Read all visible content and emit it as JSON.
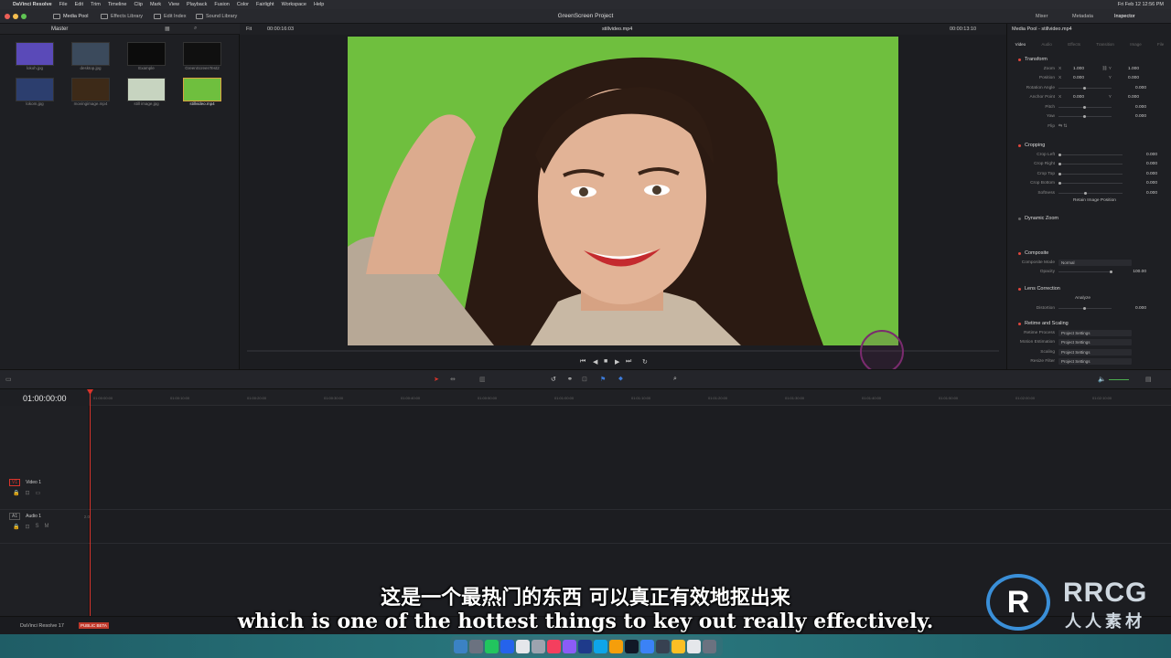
{
  "menubar": {
    "app_name": "DaVinci Resolve",
    "items": [
      "File",
      "Edit",
      "Trim",
      "Timeline",
      "Clip",
      "Mark",
      "View",
      "Playback",
      "Fusion",
      "Color",
      "Fairlight",
      "Workspace",
      "Help"
    ],
    "clock": "Fri Feb 12  12:56 PM"
  },
  "toolbar": {
    "media_pool": "Media Pool",
    "effects_library": "Effects Library",
    "edit_index": "Edit Index",
    "sound_library": "Sound Library",
    "project_title": "GreenScreen Project",
    "mixer": "Mixer",
    "metadata": "Metadata",
    "inspector": "Inspector"
  },
  "media_pool": {
    "bin_name": "Master",
    "clips": [
      {
        "name": "lokoh.jpg",
        "color": "#5a4ab8"
      },
      {
        "name": "desktop.jpg",
        "color": "#3b4a5c"
      },
      {
        "name": "Example",
        "color": "#0c0c0c"
      },
      {
        "name": "GreenScreenTest2",
        "color": "#101010"
      },
      {
        "name": "lokom.jpg",
        "color": "#2c3e6e"
      },
      {
        "name": "movingimage.mp4",
        "color": "#3d2a18"
      },
      {
        "name": "still image.jpg",
        "color": "#c7d4c0"
      },
      {
        "name": "stillvideo.mp4",
        "color": "#6fbf3e"
      }
    ]
  },
  "viewer": {
    "fit": "Fit",
    "timecode_left": "00:00:16:03",
    "clip_name": "stillvideo.mp4",
    "timecode_right": "00:00:13:10"
  },
  "inspector": {
    "title": "Media Pool - stillvideo.mp4",
    "tabs": [
      "Video",
      "Audio",
      "Effects",
      "Transition",
      "Image",
      "File"
    ],
    "transform": {
      "title": "Transform",
      "zoom_label": "Zoom",
      "zoom_x": "1.000",
      "zoom_y": "1.000",
      "position_label": "Position",
      "position_x": "0.000",
      "position_y": "0.000",
      "rotation_label": "Rotation Angle",
      "rotation": "0.000",
      "anchor_label": "Anchor Point",
      "anchor_x": "0.000",
      "anchor_y": "0.000",
      "pitch_label": "Pitch",
      "pitch": "0.000",
      "yaw_label": "Yaw",
      "yaw": "0.000",
      "flip_label": "Flip"
    },
    "cropping": {
      "title": "Cropping",
      "crop_left_label": "Crop Left",
      "crop_left": "0.000",
      "crop_right_label": "Crop Right",
      "crop_right": "0.000",
      "crop_top_label": "Crop Top",
      "crop_top": "0.000",
      "crop_bottom_label": "Crop Bottom",
      "crop_bottom": "0.000",
      "softness_label": "Softness",
      "softness": "0.000",
      "retain_button": "Retain Image Position"
    },
    "dynamic_zoom": {
      "title": "Dynamic Zoom"
    },
    "composite": {
      "title": "Composite",
      "mode_label": "Composite Mode",
      "mode": "Normal",
      "opacity_label": "Opacity",
      "opacity": "100.00"
    },
    "lens": {
      "title": "Lens Correction",
      "analyze": "Analyze",
      "distortion_label": "Distortion",
      "distortion": "0.000"
    },
    "retime": {
      "title": "Retime and Scaling",
      "retime_process_label": "Retime Process",
      "retime_process": "Project Settings",
      "motion_est_label": "Motion Estimation",
      "motion_est": "Project Settings",
      "scaling_label": "Scaling",
      "scaling": "Project Settings",
      "resize_label": "Resize Filter",
      "resize": "Project Settings"
    }
  },
  "timeline": {
    "timecode": "01:00:00:00",
    "ruler_ticks": [
      "01:00:00:00",
      "01:00:10:00",
      "01:00:20:00",
      "01:00:30:00",
      "01:00:40:00",
      "01:00:50:00",
      "01:01:00:00",
      "01:01:10:00",
      "01:01:20:00",
      "01:01:30:00",
      "01:01:40:00",
      "01:01:50:00",
      "01:02:00:00",
      "01:02:10:00"
    ],
    "video_track_id": "V1",
    "video_track_name": "Video 1",
    "audio_track_id": "A1",
    "audio_track_name": "Audio 1",
    "audio_channels": "2.0"
  },
  "footer": {
    "app_version": "DaVinci Resolve 17",
    "beta_badge": "PUBLIC BETA"
  },
  "subtitles": {
    "zh": "这是一个最热门的东西 可以真正有效地抠出来",
    "en": "which is one of the hottest things to key out really effectively."
  },
  "watermark": {
    "brand": "RRCG",
    "brand_cn": "人人素材"
  },
  "colors": {
    "accent_red": "#d9342b",
    "green_screen": "#6fbf3e",
    "panel_bg": "#1e1f23"
  }
}
